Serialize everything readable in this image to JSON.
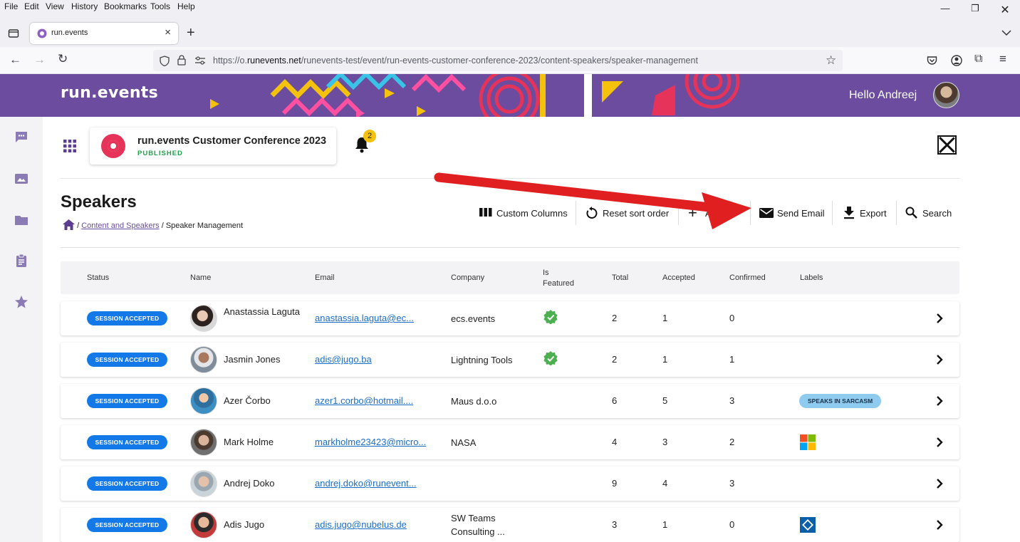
{
  "browser": {
    "menu": [
      "File",
      "Edit",
      "View",
      "History",
      "Bookmarks",
      "Tools",
      "Help"
    ],
    "tab_title": "run.events",
    "url_host": "https://o.",
    "url_domain": "runevents.net",
    "url_path": "/runevents-test/event/run-events-customer-conference-2023/content-speakers/speaker-management"
  },
  "header": {
    "logo": "run.events",
    "greeting": "Hello Andreej"
  },
  "event": {
    "title": "run.events Customer Conference 2023",
    "status": "PUBLISHED",
    "notification_count": "2"
  },
  "page": {
    "title": "Speakers",
    "breadcrumb": {
      "sep1": "/",
      "section": "Content and Speakers",
      "sep2": "/",
      "current": "Speaker Management"
    }
  },
  "actions": {
    "custom_columns": "Custom Columns",
    "reset_sort": "Reset sort order",
    "add": "A",
    "send_email": "Send Email",
    "export": "Export",
    "search": "Search"
  },
  "table": {
    "headers": {
      "status": "Status",
      "name": "Name",
      "email": "Email",
      "company": "Company",
      "featured_line1": "Is",
      "featured_line2": "Featured",
      "total": "Total",
      "accepted": "Accepted",
      "confirmed": "Confirmed",
      "labels": "Labels"
    },
    "rows": [
      {
        "status": "SESSION ACCEPTED",
        "name": "Anastassia Laguta",
        "email": "anastassia.laguta@ec...",
        "company": "ecs.events",
        "featured": true,
        "total": "2",
        "accepted": "1",
        "confirmed": "0",
        "label": ""
      },
      {
        "status": "SESSION ACCEPTED",
        "name": "Jasmin Jones",
        "email": "adis@jugo.ba",
        "company": "Lightning Tools",
        "featured": true,
        "total": "2",
        "accepted": "1",
        "confirmed": "1",
        "label": ""
      },
      {
        "status": "SESSION ACCEPTED",
        "name": "Azer Čorbo",
        "email": "azer1.corbo@hotmail....",
        "company": "Maus d.o.o",
        "featured": false,
        "total": "6",
        "accepted": "5",
        "confirmed": "3",
        "label": "SPEAKS IN SARCASM"
      },
      {
        "status": "SESSION ACCEPTED",
        "name": "Mark Holme",
        "email": "markholme23423@micro...",
        "company": "NASA",
        "featured": false,
        "total": "4",
        "accepted": "3",
        "confirmed": "2",
        "label_icon": "microsoft-logo-icon"
      },
      {
        "status": "SESSION ACCEPTED",
        "name": "Andrej Doko",
        "email": "andrej.doko@runevent...",
        "company": "",
        "featured": false,
        "total": "9",
        "accepted": "4",
        "confirmed": "3",
        "label": ""
      },
      {
        "status": "SESSION ACCEPTED",
        "name": "Adis Jugo",
        "email": "adis.jugo@nubelus.de",
        "company": "SW Teams Consulting ...",
        "featured": false,
        "total": "3",
        "accepted": "1",
        "confirmed": "0",
        "label_icon": "mvp-badge-icon"
      }
    ]
  },
  "colors": {
    "brand_purple": "#6b4c9e",
    "status_blue": "#1479e8",
    "featured_green": "#4caf50",
    "annotation_red": "#e02020"
  }
}
